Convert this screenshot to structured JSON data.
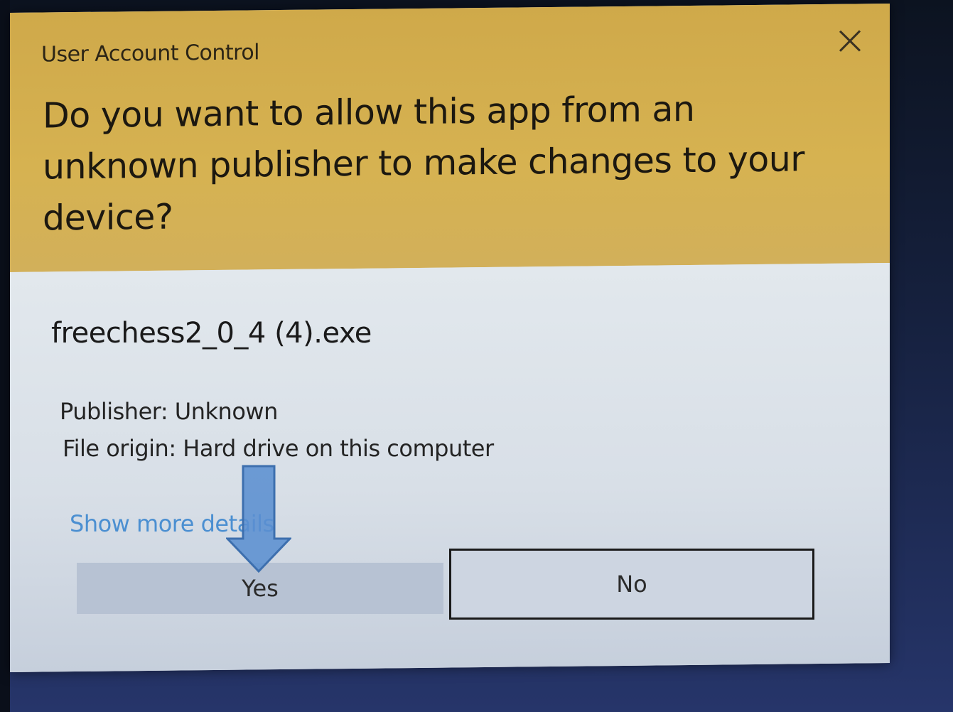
{
  "dialog": {
    "title": "User Account Control",
    "question": "Do you want to allow this app from an unknown publisher to make changes to your device?",
    "file_name": "freechess2_0_4 (4).exe",
    "publisher_line": "Publisher: Unknown",
    "origin_line": "File origin: Hard drive on this computer",
    "more_details_link": "Show more details",
    "yes_label": "Yes",
    "no_label": "No",
    "close_icon": "close-icon"
  },
  "annotation": {
    "icon": "arrow-down-icon",
    "color": "#5b8fd0"
  },
  "colors": {
    "header": "#d6b251",
    "body": "#dbe3ea",
    "link": "#4b8fd1"
  }
}
